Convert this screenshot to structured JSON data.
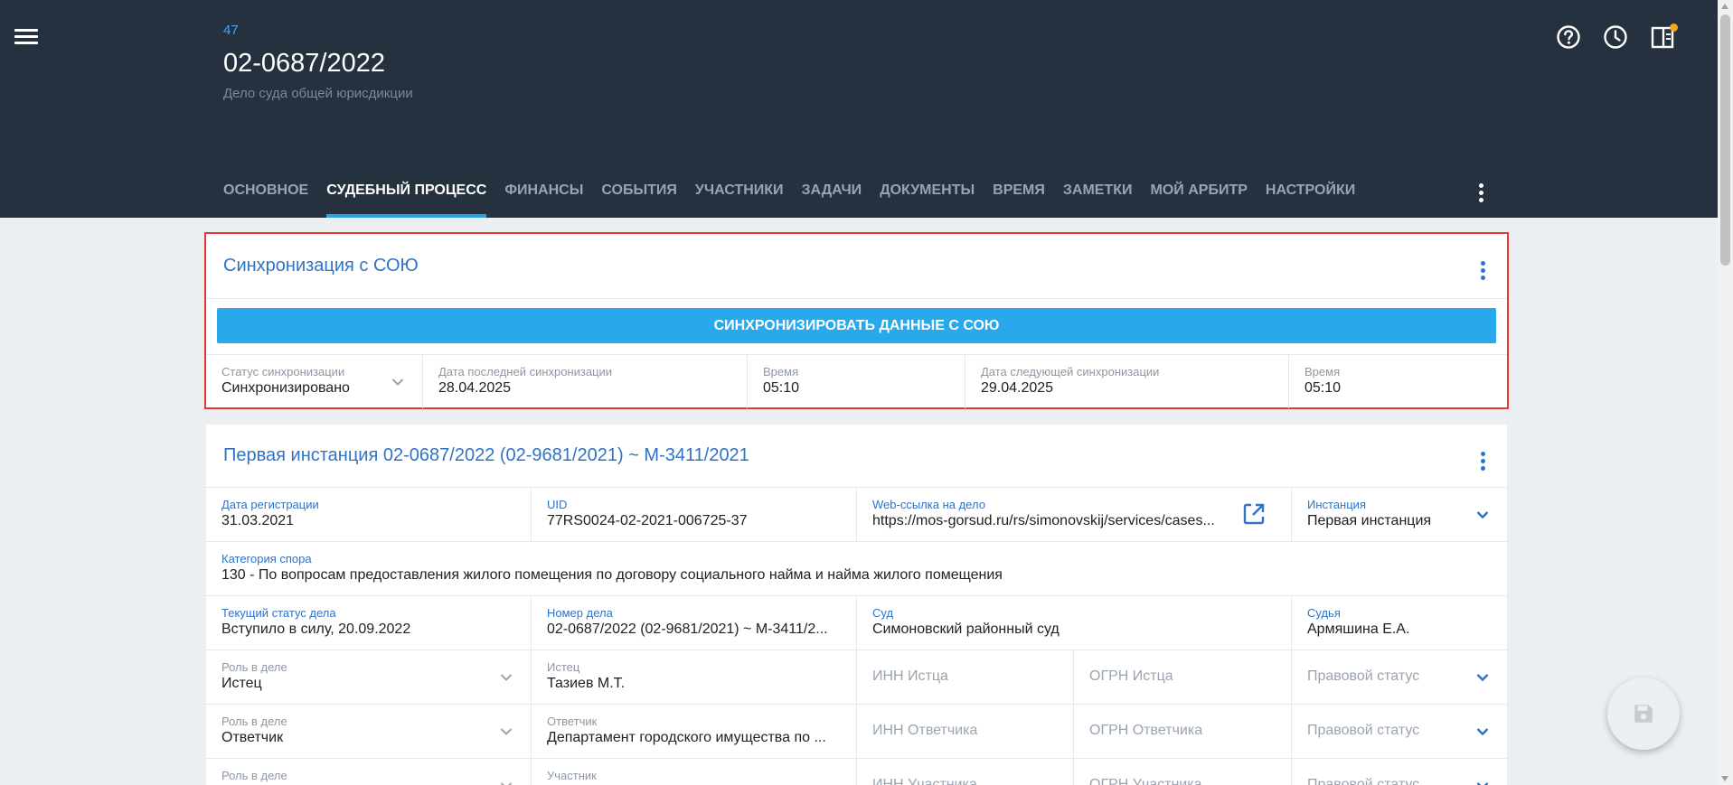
{
  "header": {
    "case_id": "47",
    "case_title": "02-0687/2022",
    "case_subtitle": "Дело суда общей юрисдикции",
    "icons": [
      "menu-icon",
      "help-icon",
      "history-icon",
      "panel-icon"
    ]
  },
  "tabs": [
    {
      "label": "ОСНОВНОЕ"
    },
    {
      "label": "СУДЕБНЫЙ ПРОЦЕСС"
    },
    {
      "label": "ФИНАНСЫ"
    },
    {
      "label": "СОБЫТИЯ"
    },
    {
      "label": "УЧАСТНИКИ"
    },
    {
      "label": "ЗАДАЧИ"
    },
    {
      "label": "ДОКУМЕНТЫ"
    },
    {
      "label": "ВРЕМЯ"
    },
    {
      "label": "ЗАМЕТКИ"
    },
    {
      "label": "МОЙ АРБИТР"
    },
    {
      "label": "НАСТРОЙКИ"
    }
  ],
  "active_tab": "СУДЕБНЫЙ ПРОЦЕСС",
  "sync": {
    "title": "Синхронизация с СОЮ",
    "button_label": "СИНХРОНИЗИРОВАТЬ ДАННЫЕ С СОЮ",
    "status_label": "Статус синхронизации",
    "status_value": "Синхронизировано",
    "last_date_label": "Дата последней синхронизации",
    "last_date_value": "28.04.2025",
    "last_time_label": "Время",
    "last_time_value": "05:10",
    "next_date_label": "Дата следующей синхронизации",
    "next_date_value": "29.04.2025",
    "next_time_label": "Время",
    "next_time_value": "05:10"
  },
  "instance": {
    "title": "Первая инстанция 02-0687/2022 (02-9681/2021) ~ М-3411/2021",
    "reg_date_label": "Дата регистрации",
    "reg_date_value": "31.03.2021",
    "uid_label": "UID",
    "uid_value": "77RS0024-02-2021-006725-37",
    "web_label": "Web-ссылка на дело",
    "web_value": "https://mos-gorsud.ru/rs/simonovskij/services/cases...",
    "instance_label": "Инстанция",
    "instance_value": "Первая инстанция",
    "category_label": "Категория спора",
    "category_value": "130 - По вопросам предоставления жилого помещения по договору социального найма и найма жилого помещения",
    "status_label": "Текущий статус дела",
    "status_value": "Вступило в силу, 20.09.2022",
    "case_no_label": "Номер дела",
    "case_no_value": "02-0687/2022 (02-9681/2021) ~ М-3411/2...",
    "court_label": "Суд",
    "court_value": "Симоновский районный суд",
    "judge_label": "Судья",
    "judge_value": "Армяшина Е.А.",
    "parties": [
      {
        "role_label": "Роль в деле",
        "role_value": "Истец",
        "party_label": "Истец",
        "party_value": "Тазиев М.Т.",
        "inn_placeholder": "ИНН Истца",
        "ogrn_placeholder": "ОГРН Истца",
        "legal_status_placeholder": "Правовой статус"
      },
      {
        "role_label": "Роль в деле",
        "role_value": "Ответчик",
        "party_label": "Ответчик",
        "party_value": "Департамент городского имущества по ...",
        "inn_placeholder": "ИНН Ответчика",
        "ogrn_placeholder": "ОГРН Ответчика",
        "legal_status_placeholder": "Правовой статус"
      },
      {
        "role_label": "Роль в деле",
        "role_value": "",
        "party_label": "Участник",
        "party_value": "",
        "inn_placeholder": "ИНН Участника",
        "ogrn_placeholder": "ОГРН Участника",
        "legal_status_placeholder": "Правовой статус"
      }
    ]
  },
  "fab": {
    "icon": "save-icon"
  },
  "colors": {
    "header_bg": "#25313f",
    "accent": "#29a8ec",
    "link_blue": "#2e73c7",
    "highlight": "#e53935",
    "notification": "#f5a623"
  }
}
